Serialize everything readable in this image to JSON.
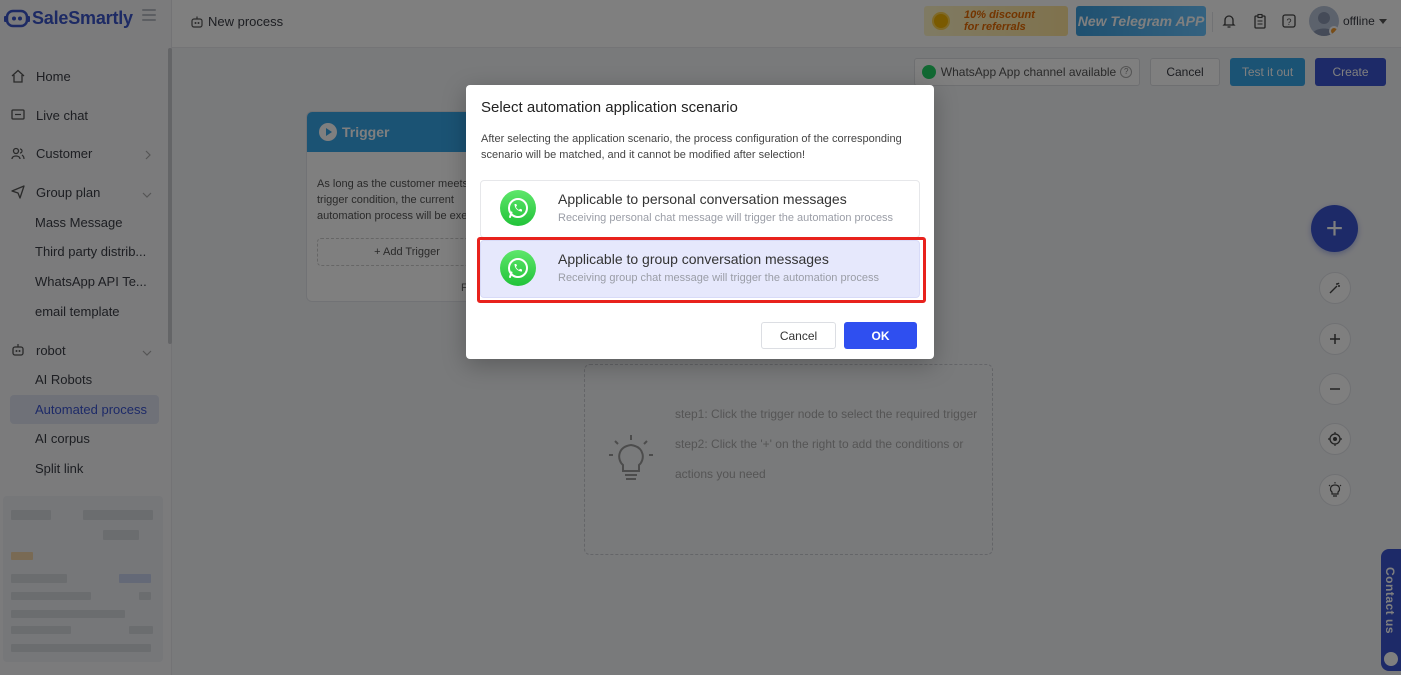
{
  "app": {
    "brand": "SaleSmartly"
  },
  "sidebar": {
    "items": [
      {
        "label": "Home",
        "icon": "home-icon"
      },
      {
        "label": "Live chat",
        "icon": "chat-icon"
      },
      {
        "label": "Customer",
        "icon": "customer-icon"
      },
      {
        "label": "Group plan",
        "icon": "send-icon"
      },
      {
        "label": "robot",
        "icon": "robot-icon"
      }
    ],
    "group_plan_sub": [
      "Mass Message",
      "Third party distrib...",
      "WhatsApp API Te...",
      "email template"
    ],
    "robot_sub": [
      "AI Robots",
      "Automated process",
      "AI corpus",
      "Split link"
    ],
    "active": "Automated process"
  },
  "header": {
    "page_title": "New process",
    "promo_discount_line1": "10% discount",
    "promo_discount_line2": "for referrals",
    "promo_telegram": "New Telegram APP",
    "status": "offline"
  },
  "toolbar": {
    "whatsapp_chip": "WhatsApp App channel available",
    "cancel": "Cancel",
    "test": "Test it out",
    "create": "Create"
  },
  "trigger": {
    "title": "Trigger",
    "description": "As long as the customer meets the trigger condition, the current automation process will be executed",
    "add_button": "+ Add Trigger",
    "footer": "F"
  },
  "tips": {
    "step1": "step1: Click the trigger node to select the required trigger",
    "step2": "step2: Click the '+' on the right to add the conditions or actions you need"
  },
  "contact": {
    "label": "Contact us"
  },
  "modal": {
    "title": "Select automation application scenario",
    "description": "After selecting the application scenario, the process configuration of the corresponding scenario will be matched, and it cannot be modified after selection!",
    "options": [
      {
        "title": "Applicable to personal conversation messages",
        "subtitle": "Receiving personal chat message will trigger the automation process",
        "selected": false
      },
      {
        "title": "Applicable to group conversation messages",
        "subtitle": "Receiving group chat message will trigger the automation process",
        "selected": true
      }
    ],
    "cancel": "Cancel",
    "ok": "OK"
  },
  "colors": {
    "brand": "#3b55d0",
    "accent_blue": "#36a6e8",
    "whatsapp": "#25d366",
    "highlight": "#e8221d"
  }
}
